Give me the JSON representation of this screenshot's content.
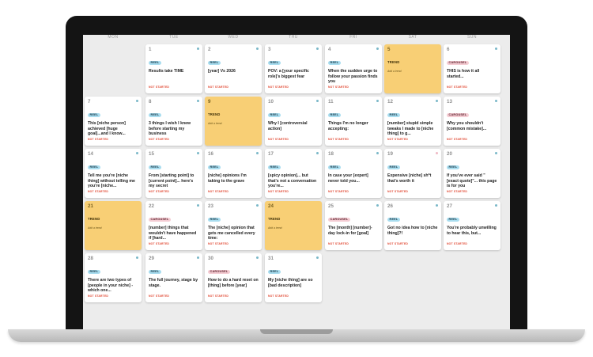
{
  "weekdays": [
    "MON",
    "TUE",
    "WED",
    "THU",
    "FRI",
    "SAT",
    "SUN"
  ],
  "cells": [
    {
      "empty": true
    },
    {
      "day": "1",
      "tag": "REEL",
      "title": "Results take TIME",
      "status": "NOT STARTED",
      "dot": "blue"
    },
    {
      "day": "2",
      "tag": "REEL",
      "title": "[year] Vs 2026",
      "status": "NOT STARTED",
      "dot": "blue"
    },
    {
      "day": "3",
      "tag": "REEL",
      "title": "POV: a [your specific role]'s biggest fear",
      "status": "NOT STARTED",
      "dot": "blue"
    },
    {
      "day": "4",
      "tag": "REEL",
      "title": "When the sudden urge to follow your passion finds you",
      "status": "NOT STARTED",
      "dot": "blue"
    },
    {
      "day": "5",
      "trend": true,
      "tag": "TREND",
      "sub": "Add a trend"
    },
    {
      "day": "6",
      "tag": "CAROUSEL",
      "title": "THIS is how it all started...",
      "status": "NOT STARTED",
      "dot": "blue"
    },
    {
      "day": "7",
      "tag": "REEL",
      "title": "This [niche person] achieved [huge goal]...and I know...",
      "status": "NOT STARTED",
      "dot": "blue"
    },
    {
      "day": "8",
      "tag": "REEL",
      "title": "3 things I wish I knew before starting my business",
      "status": "NOT STARTED",
      "dot": "blue"
    },
    {
      "day": "9",
      "trend": true,
      "tag": "TREND",
      "sub": "Add a trend"
    },
    {
      "day": "10",
      "tag": "REEL",
      "title": "Why I [controversial action]",
      "status": "NOT STARTED",
      "dot": "blue"
    },
    {
      "day": "11",
      "tag": "REEL",
      "title": "Things I'm no longer accepting:",
      "status": "NOT STARTED",
      "dot": "blue"
    },
    {
      "day": "12",
      "tag": "REEL",
      "title": "[number] stupid simple tweaks I made to [niche thing] to g...",
      "status": "NOT STARTED",
      "dot": "blue"
    },
    {
      "day": "13",
      "tag": "CAROUSEL",
      "title": "Why you shouldn't [common mistake]...",
      "status": "NOT STARTED",
      "dot": "blue"
    },
    {
      "day": "14",
      "tag": "REEL",
      "title": "Tell me you're [niche thing] without telling me you're [niche...",
      "status": "NOT STARTED",
      "dot": "blue"
    },
    {
      "day": "15",
      "tag": "REEL",
      "title": "From [starting point] to [current point]... here's my secret",
      "status": "NOT STARTED",
      "dot": "blue"
    },
    {
      "day": "16",
      "tag": "REEL",
      "title": "[niche] opinions I'm taking to the grave",
      "status": "NOT STARTED",
      "dot": "blue"
    },
    {
      "day": "17",
      "tag": "REEL",
      "title": "[spicy opinion]... but that's not a conversation you're...",
      "status": "NOT STARTED",
      "dot": "blue"
    },
    {
      "day": "18",
      "tag": "REEL",
      "title": "In case your [expert] never told you...",
      "status": "NOT STARTED",
      "dot": "blue"
    },
    {
      "day": "19",
      "tag": "REEL",
      "title": "Expensive [niche] sh*t that's worth it",
      "status": "NOT STARTED",
      "dot": "pink"
    },
    {
      "day": "20",
      "tag": "REEL",
      "title": "If you've ever said \" [exact quote]\"... this page is for you",
      "status": "NOT STARTED",
      "dot": "blue"
    },
    {
      "day": "21",
      "trend": true,
      "tag": "TREND",
      "sub": "Add a trend"
    },
    {
      "day": "22",
      "tag": "CAROUSEL",
      "title": "[number] things that wouldn't have happened if [hard...",
      "status": "NOT STARTED",
      "dot": "blue"
    },
    {
      "day": "23",
      "tag": "REEL",
      "title": "The [niche] opinion that gets me cancelled every time:",
      "status": "NOT STARTED",
      "dot": "blue"
    },
    {
      "day": "24",
      "trend": true,
      "tag": "TREND",
      "sub": "Add a trend"
    },
    {
      "day": "25",
      "tag": "CAROUSEL",
      "title": "The [month] [number]-day lock-in for [goal]",
      "status": "NOT STARTED",
      "dot": "blue"
    },
    {
      "day": "26",
      "tag": "REEL",
      "title": "Got no idea how to [niche thing]?!",
      "status": "NOT STARTED",
      "dot": "blue"
    },
    {
      "day": "27",
      "tag": "REEL",
      "title": "You're probably unwilling to hear this, but...",
      "status": "NOT STARTED",
      "dot": "blue"
    },
    {
      "day": "28",
      "tag": "REEL",
      "title": "There are two types of [people in your niche] - which one...",
      "status": "NOT STARTED",
      "dot": "blue"
    },
    {
      "day": "29",
      "tag": "REEL",
      "title": "The full journey, stage by stage.",
      "status": "NOT STARTED",
      "dot": "blue"
    },
    {
      "day": "30",
      "tag": "CAROUSEL",
      "title": "How to do a hard reset on [thing] before [year]",
      "status": "NOT STARTED",
      "dot": "blue"
    },
    {
      "day": "31",
      "tag": "REEL",
      "title": "My [niche thing] are so [bad description]",
      "status": "NOT STARTED",
      "dot": "blue"
    }
  ]
}
